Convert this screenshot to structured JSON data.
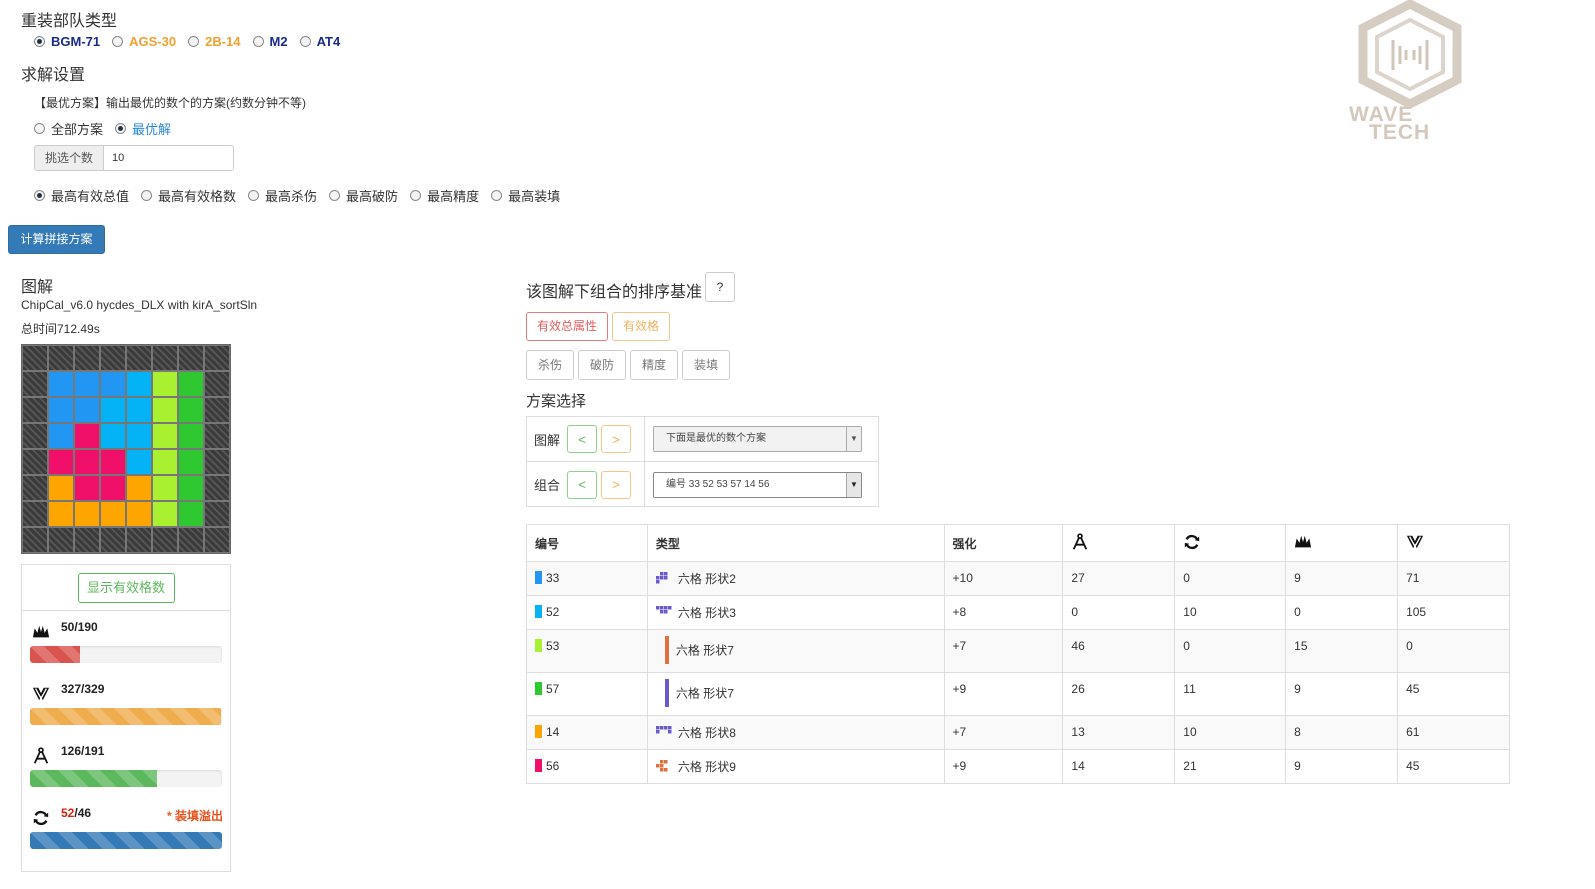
{
  "troop_type": {
    "title": "重装部队类型",
    "options": [
      {
        "label": "BGM-71",
        "color": "#1a2a8c",
        "selected": true
      },
      {
        "label": "AGS-30",
        "color": "#f0a030",
        "selected": false
      },
      {
        "label": "2B-14",
        "color": "#f0a030",
        "selected": false
      },
      {
        "label": "M2",
        "color": "#1a2a8c",
        "selected": false
      },
      {
        "label": "AT4",
        "color": "#1a2a8c",
        "selected": false
      }
    ]
  },
  "solve_settings": {
    "title": "求解设置",
    "hint": "【最优方案】输出最优的数个的方案(约数分钟不等)",
    "mode_options": [
      {
        "label": "全部方案",
        "selected": false
      },
      {
        "label": "最优解",
        "selected": true
      }
    ],
    "pick_count_label": "挑选个数",
    "pick_count_value": "10",
    "criteria_options": [
      {
        "label": "最高有效总值",
        "selected": true
      },
      {
        "label": "最高有效格数",
        "selected": false
      },
      {
        "label": "最高杀伤",
        "selected": false
      },
      {
        "label": "最高破防",
        "selected": false
      },
      {
        "label": "最高精度",
        "selected": false
      },
      {
        "label": "最高装填",
        "selected": false
      }
    ],
    "calc_button": "计算拼接方案"
  },
  "diagram": {
    "title": "图解",
    "version": "ChipCal_v6.0 hycdes_DLX with kirA_sortSln",
    "total_time": "总时间712.49s",
    "grid": [
      [
        "off",
        "off",
        "off",
        "off",
        "off",
        "off",
        "off",
        "off"
      ],
      [
        "off",
        "#2196f3",
        "#2196f3",
        "#2196f3",
        "#03b3f5",
        "#a8f030",
        "#30c830",
        "off"
      ],
      [
        "off",
        "#2196f3",
        "#2196f3",
        "#03b3f5",
        "#03b3f5",
        "#a8f030",
        "#30c830",
        "off"
      ],
      [
        "off",
        "#2196f3",
        "#f0106a",
        "#03b3f5",
        "#03b3f5",
        "#a8f030",
        "#30c830",
        "off"
      ],
      [
        "off",
        "#f0106a",
        "#f0106a",
        "#f0106a",
        "#03b3f5",
        "#a8f030",
        "#30c830",
        "off"
      ],
      [
        "off",
        "#ffa500",
        "#f0106a",
        "#f0106a",
        "#ffa500",
        "#a8f030",
        "#30c830",
        "off"
      ],
      [
        "off",
        "#ffa500",
        "#ffa500",
        "#ffa500",
        "#ffa500",
        "#a8f030",
        "#30c830",
        "off"
      ],
      [
        "off",
        "off",
        "off",
        "off",
        "off",
        "off",
        "off",
        "off"
      ]
    ],
    "show_cells_button": "显示有效格数",
    "stats": [
      {
        "icon": "crown-icon",
        "value": "50",
        "max": "190",
        "fraction": 0.263,
        "color": "#d9534f",
        "overflow": false,
        "note": ""
      },
      {
        "icon": "armor-break-icon",
        "value": "327",
        "max": "329",
        "fraction": 0.994,
        "color": "#f0ad4e",
        "overflow": false,
        "note": ""
      },
      {
        "icon": "compass-icon",
        "value": "126",
        "max": "191",
        "fraction": 0.66,
        "color": "#5cb85c",
        "overflow": false,
        "note": ""
      },
      {
        "icon": "reload-icon",
        "value": "52",
        "max": "46",
        "fraction": 1.0,
        "color": "#337ab7",
        "overflow": true,
        "note": "* 装填溢出"
      }
    ]
  },
  "sort_basis": {
    "title": "该图解下组合的排序基准",
    "help_button": "?",
    "buttons_row1": [
      {
        "label": "有效总属性",
        "style": "danger"
      },
      {
        "label": "有效格",
        "style": "warning"
      }
    ],
    "buttons_row2": [
      "杀伤",
      "破防",
      "精度",
      "装填"
    ]
  },
  "plan_select": {
    "title": "方案选择",
    "rows": [
      {
        "label": "图解",
        "prev": "<",
        "next": ">",
        "select": "下面是最优的数个方案"
      },
      {
        "label": "组合",
        "prev": "<",
        "next": ">",
        "select": "编号 33 52 53 57 14 56"
      }
    ]
  },
  "chip_table": {
    "headers": [
      "编号",
      "类型",
      "强化",
      "compass-icon",
      "reload-icon",
      "crown-icon",
      "armor-break-icon"
    ],
    "rows": [
      {
        "id": "33",
        "color": "#2196f3",
        "type": "六格 形状2",
        "shape_icon": "shape-2-icon",
        "shape_color": "#6a5acd",
        "enhance": "+10",
        "a": "27",
        "b": "0",
        "c": "9",
        "d": "71"
      },
      {
        "id": "52",
        "color": "#03b3f5",
        "type": "六格 形状3",
        "shape_icon": "shape-3-icon",
        "shape_color": "#6a5acd",
        "enhance": "+8",
        "a": "0",
        "b": "10",
        "c": "0",
        "d": "105"
      },
      {
        "id": "53",
        "color": "#a8f030",
        "type": "六格 形状7",
        "shape_icon": "shape-7-icon",
        "shape_color": "#e07040",
        "enhance": "+7",
        "a": "46",
        "b": "0",
        "c": "15",
        "d": "0"
      },
      {
        "id": "57",
        "color": "#30c830",
        "type": "六格 形状7",
        "shape_icon": "shape-7-icon",
        "shape_color": "#6a5acd",
        "enhance": "+9",
        "a": "26",
        "b": "11",
        "c": "9",
        "d": "45"
      },
      {
        "id": "14",
        "color": "#ffa500",
        "type": "六格 形状8",
        "shape_icon": "shape-8-icon",
        "shape_color": "#6a5acd",
        "enhance": "+7",
        "a": "13",
        "b": "10",
        "c": "8",
        "d": "61"
      },
      {
        "id": "56",
        "color": "#f0106a",
        "type": "六格 形状9",
        "shape_icon": "shape-9-icon",
        "shape_color": "#e07040",
        "enhance": "+9",
        "a": "14",
        "b": "21",
        "c": "9",
        "d": "45"
      }
    ]
  },
  "logo": {
    "line1": "WAVE",
    "line2": "TECH",
    "color": "#c9bfb3"
  }
}
